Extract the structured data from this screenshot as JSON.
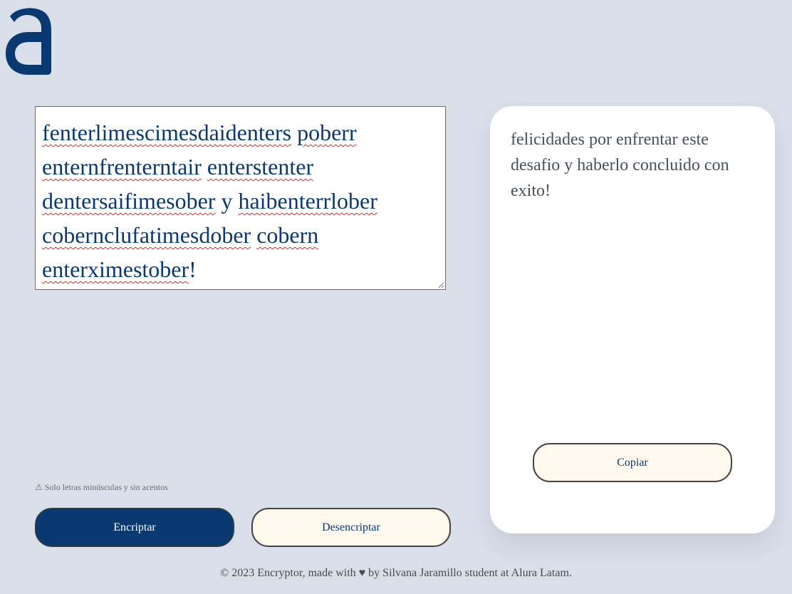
{
  "brand": {
    "logo_icon": "alura-a-logo",
    "logo_color": "#0a3871"
  },
  "input": {
    "words": [
      "fenterlimescimesdaidenters",
      "poberr",
      "enternfrenterntair",
      "enterstenter",
      "dentersaifimesober",
      "y",
      "haibenterrlober",
      "cobernclufatimesdober",
      "cobern",
      "enterximestober",
      "!"
    ],
    "misspelled_flags": [
      true,
      true,
      true,
      true,
      true,
      false,
      true,
      true,
      true,
      true,
      false
    ]
  },
  "warning": {
    "icon": "warning-icon",
    "text": "⚠ Solo letras minúsculas y sin acentos"
  },
  "buttons": {
    "encrypt_label": "Encriptar",
    "decrypt_label": "Desencriptar",
    "copy_label": "Copiar"
  },
  "output": {
    "text": "felicidades por enfrentar este desafio y haberlo concluido con exito!"
  },
  "footer": {
    "text": "© 2023 Encryptor, made with ♥ by Silvana Jaramillo student at Alura Latam."
  },
  "colors": {
    "background": "#d9dfe9",
    "primary": "#0a3871",
    "secondary_button": "#fef9ec",
    "card": "#ffffff"
  }
}
